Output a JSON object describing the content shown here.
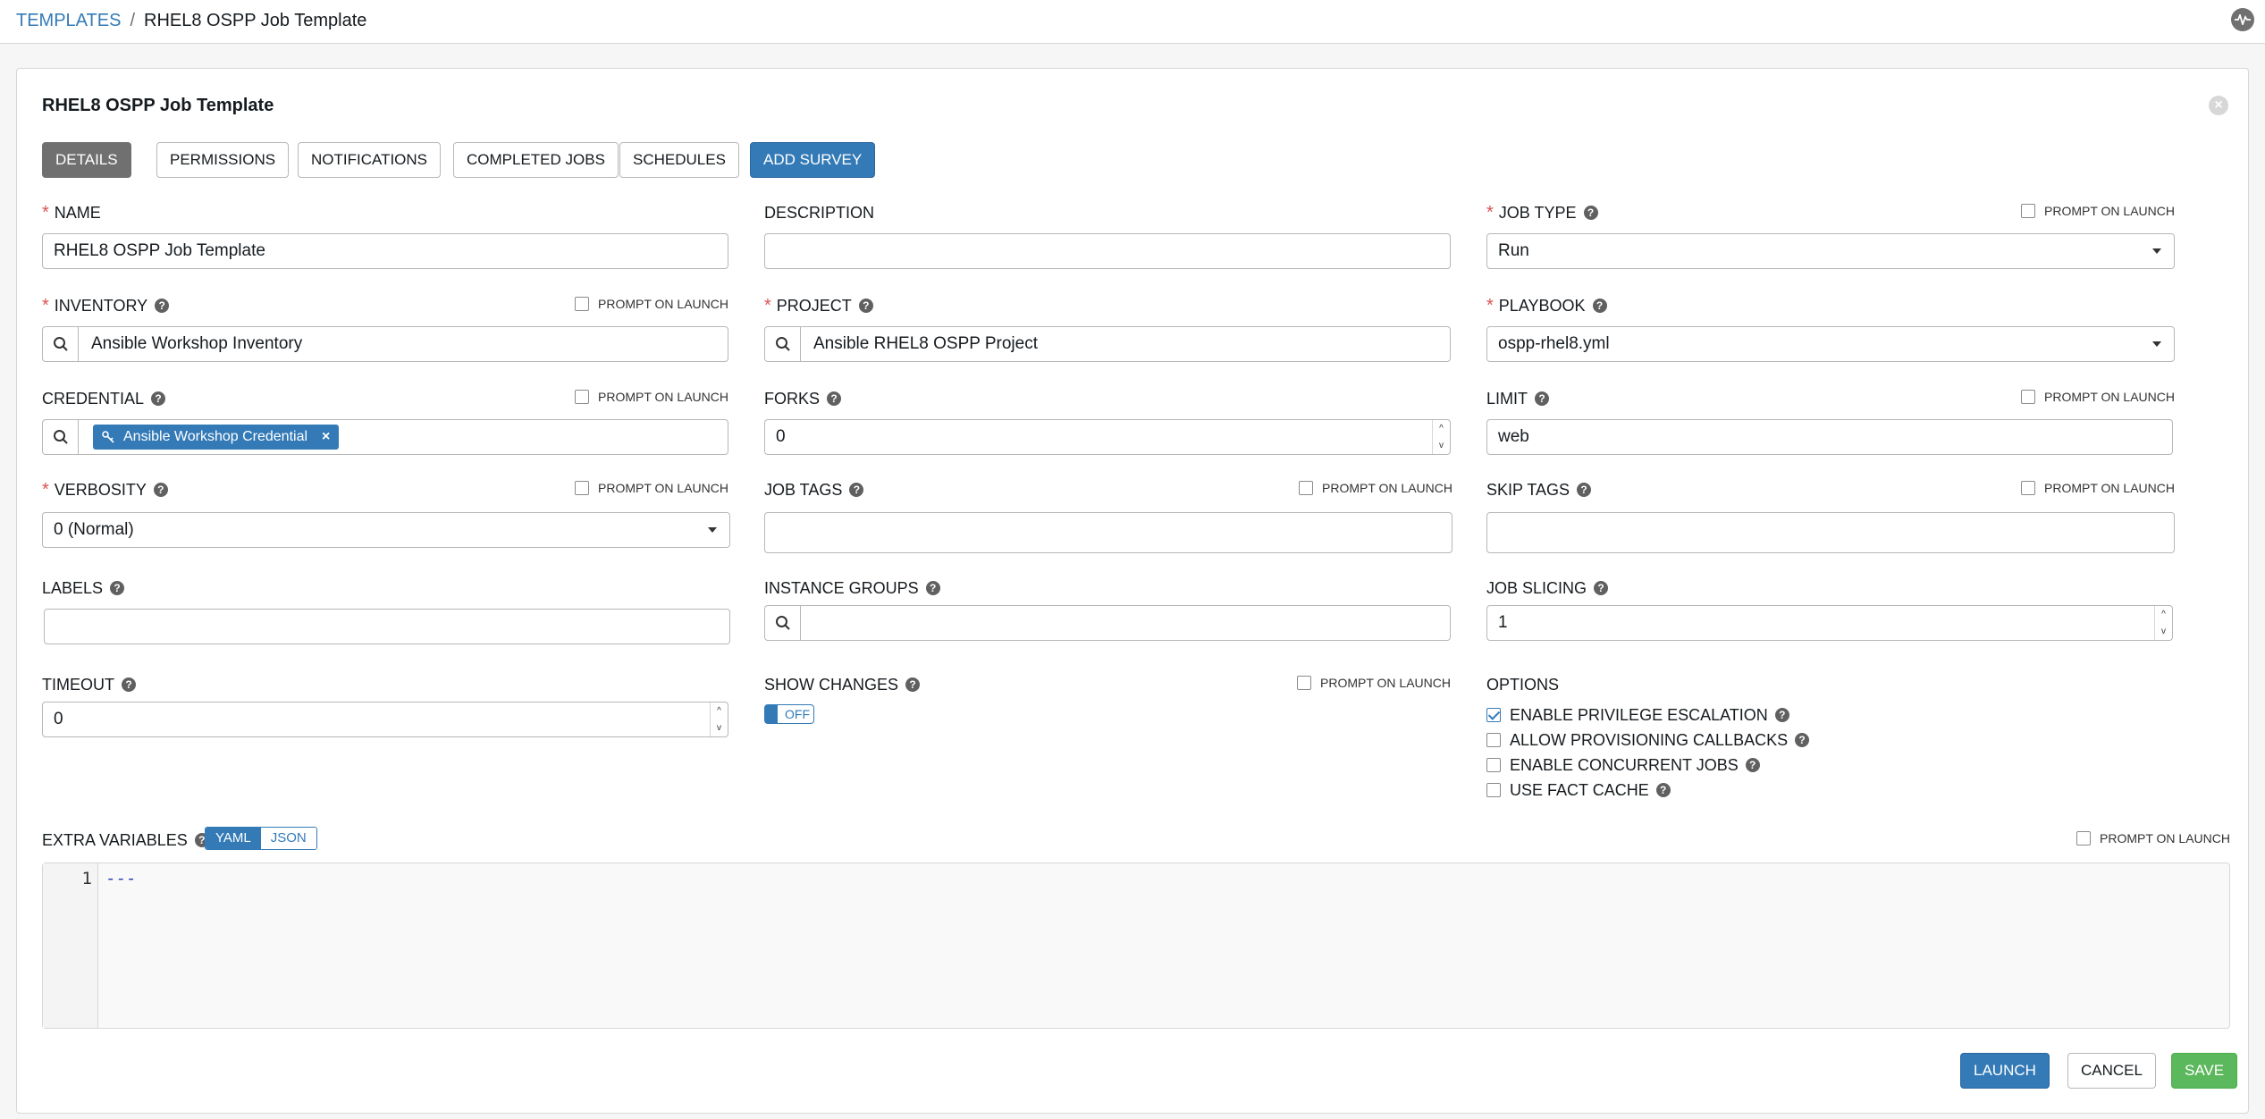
{
  "breadcrumb": {
    "parent": "TEMPLATES",
    "separator": "/",
    "current": "RHEL8 OSPP Job Template"
  },
  "panel": {
    "title": "RHEL8 OSPP Job Template"
  },
  "tabs": {
    "details": "DETAILS",
    "permissions": "PERMISSIONS",
    "notifications": "NOTIFICATIONS",
    "completed_jobs": "COMPLETED JOBS",
    "schedules": "SCHEDULES",
    "add_survey": "ADD SURVEY"
  },
  "prompt_on_launch": "PROMPT ON LAUNCH",
  "help_glyph": "?",
  "required_mark": "*",
  "fields": {
    "name": {
      "label": "NAME",
      "value": "RHEL8 OSPP Job Template"
    },
    "description": {
      "label": "DESCRIPTION",
      "value": ""
    },
    "job_type": {
      "label": "JOB TYPE",
      "value": "Run"
    },
    "inventory": {
      "label": "INVENTORY",
      "value": "Ansible Workshop Inventory"
    },
    "project": {
      "label": "PROJECT",
      "value": "Ansible RHEL8 OSPP Project"
    },
    "playbook": {
      "label": "PLAYBOOK",
      "value": "ospp-rhel8.yml"
    },
    "credential": {
      "label": "CREDENTIAL",
      "chip": "Ansible Workshop Credential",
      "chip_remove": "×"
    },
    "forks": {
      "label": "FORKS",
      "value": "0"
    },
    "limit": {
      "label": "LIMIT",
      "value": "web"
    },
    "verbosity": {
      "label": "VERBOSITY",
      "value": "0 (Normal)"
    },
    "job_tags": {
      "label": "JOB TAGS",
      "value": ""
    },
    "skip_tags": {
      "label": "SKIP TAGS",
      "value": ""
    },
    "labels": {
      "label": "LABELS",
      "value": ""
    },
    "instance_groups": {
      "label": "INSTANCE GROUPS",
      "value": ""
    },
    "job_slicing": {
      "label": "JOB SLICING",
      "value": "1"
    },
    "timeout": {
      "label": "TIMEOUT",
      "value": "0"
    },
    "show_changes": {
      "label": "SHOW CHANGES",
      "toggle": "OFF"
    }
  },
  "options": {
    "label": "OPTIONS",
    "items": [
      {
        "label": "ENABLE PRIVILEGE ESCALATION",
        "checked": true
      },
      {
        "label": "ALLOW PROVISIONING CALLBACKS",
        "checked": false
      },
      {
        "label": "ENABLE CONCURRENT JOBS",
        "checked": false
      },
      {
        "label": "USE FACT CACHE",
        "checked": false
      }
    ]
  },
  "extra_variables": {
    "label": "EXTRA VARIABLES",
    "format_yaml": "YAML",
    "format_json": "JSON",
    "active_format": "YAML",
    "line_number": "1",
    "code": "---"
  },
  "actions": {
    "launch": "LAUNCH",
    "cancel": "CANCEL",
    "save": "SAVE"
  },
  "spinner": {
    "up": "^",
    "down": "v"
  },
  "close_glyph": "×",
  "colors": {
    "accent": "#337ab7",
    "success": "#5cb85c",
    "required": "#d9534f",
    "active_tab": "#707070"
  }
}
